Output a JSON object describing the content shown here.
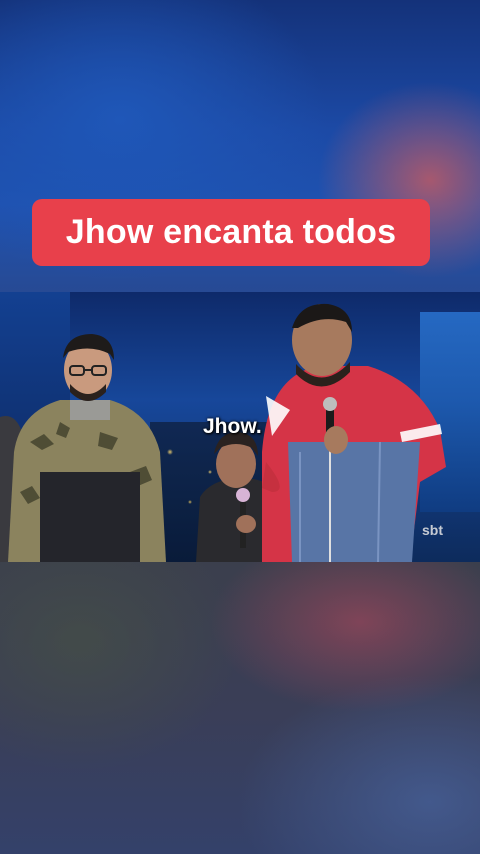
{
  "title_banner": {
    "text": "Jhow encanta todos",
    "color": "#e8404b"
  },
  "video": {
    "caption": "Jhow.",
    "channel_logo": "sbt"
  }
}
